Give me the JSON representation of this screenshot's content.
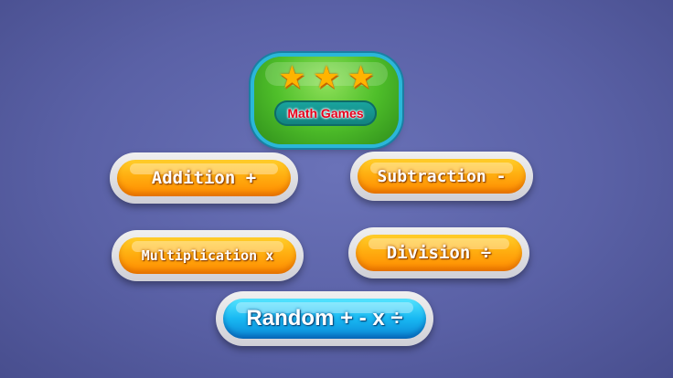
{
  "logo": {
    "title": "Math Games",
    "stars": [
      "★",
      "★",
      "★"
    ],
    "icon": "three-stars-icon"
  },
  "buttons": {
    "addition": "Addition +",
    "subtraction": "Subtraction -",
    "multiplication": "Multiplication x",
    "division": "Division ÷",
    "random": "Random + - x ÷"
  },
  "colors": {
    "background": "#5a61a6",
    "orange_button": "#ffae10",
    "blue_button": "#18b8f2",
    "logo_green": "#4fbf2a",
    "title_red": "#e8001c"
  }
}
